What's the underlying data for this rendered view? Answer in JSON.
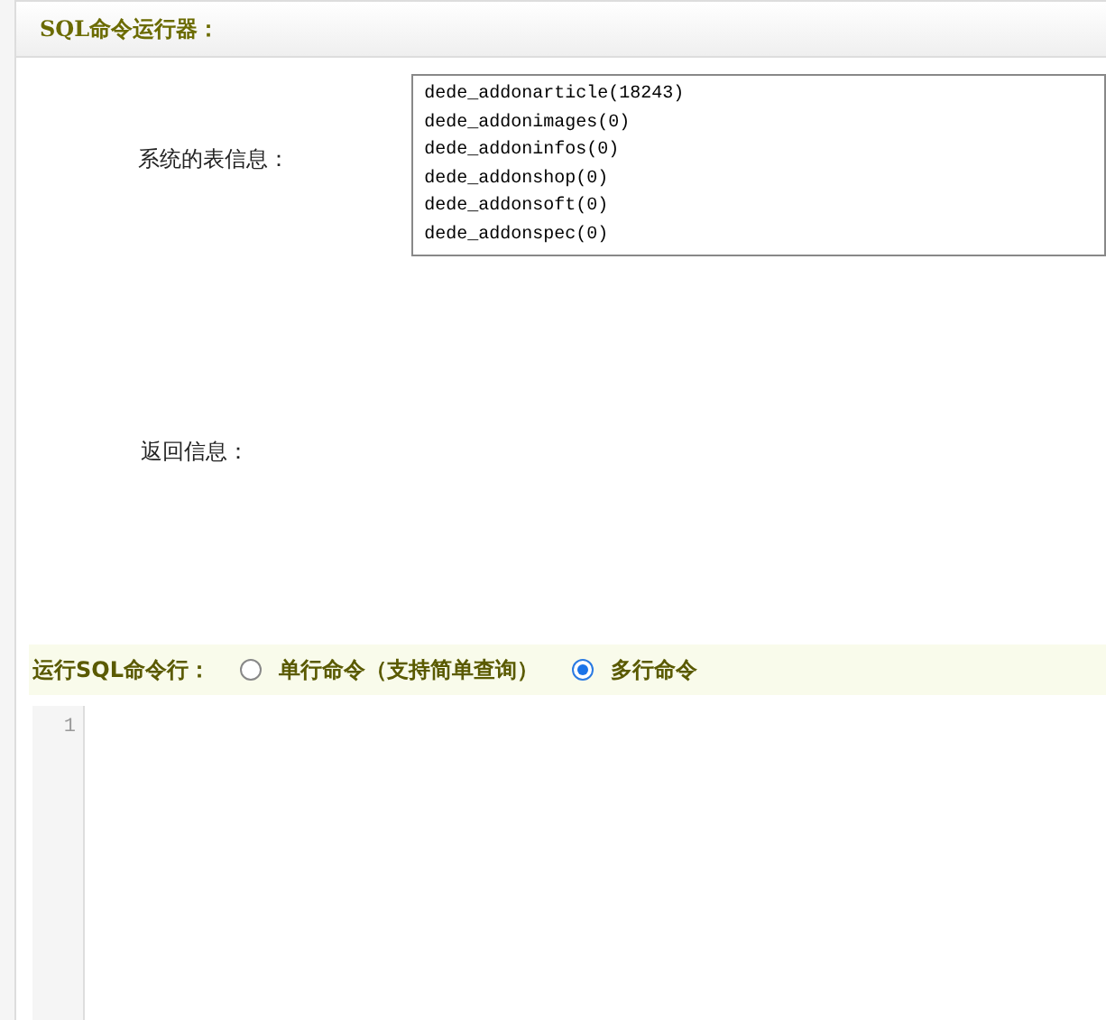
{
  "panel": {
    "title": "SQL命令运行器："
  },
  "table_info": {
    "label": "系统的表信息：",
    "tables": [
      "dede_addonarticle(18243)",
      "dede_addonimages(0)",
      "dede_addoninfos(0)",
      "dede_addonshop(0)",
      "dede_addonsoft(0)",
      "dede_addonspec(0)"
    ]
  },
  "return_info": {
    "label": "返回信息："
  },
  "run_bar": {
    "label": "运行SQL命令行：",
    "options": [
      {
        "label": "单行命令（支持简单查询）",
        "selected": false
      },
      {
        "label": "多行命令",
        "selected": true
      }
    ]
  },
  "editor": {
    "line_numbers": [
      "1"
    ]
  }
}
